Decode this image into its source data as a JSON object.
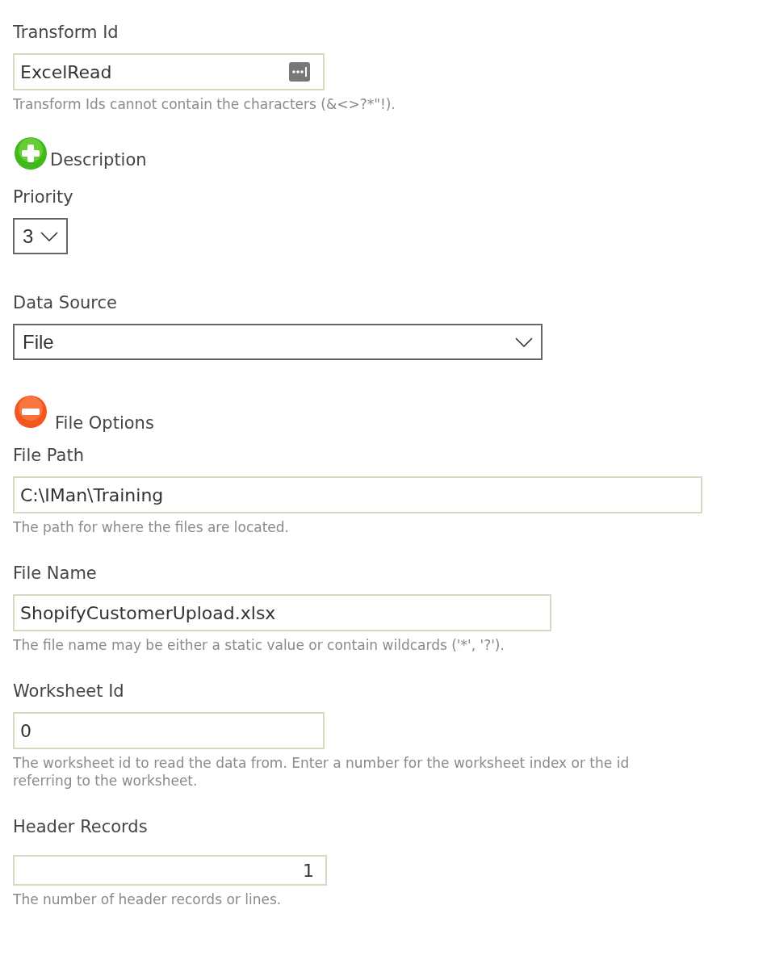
{
  "fields": [
    {
      "kind": "text",
      "label": "Transform Id",
      "value": "ExcelRead",
      "has_button": true,
      "hint": "Transform Ids cannot contain the characters (&<>?*\"!)."
    },
    {
      "kind": "toggle",
      "label": "Description",
      "expanded": false
    },
    {
      "kind": "select",
      "label": "Priority",
      "value": "3"
    },
    {
      "kind": "select",
      "label": "Data Source",
      "value": "File"
    },
    {
      "kind": "toggle",
      "label": "File Options",
      "expanded": true
    },
    {
      "kind": "text",
      "label": "File Path",
      "value": "C:\\IMan\\Training",
      "hint": "The path for where the files are located."
    },
    {
      "kind": "text",
      "label": "File Name",
      "value": "ShopifyCustomerUpload.xlsx",
      "hint": "The file name may be either a static value or contain wildcards ('*', '?')."
    },
    {
      "kind": "text",
      "label": "Worksheet Id",
      "value": "0",
      "hint": "The worksheet id to read the data from. Enter a number for the worksheet index or the id referring to the worksheet."
    },
    {
      "kind": "number",
      "label": "Header Records",
      "value": "1",
      "hint": "The number of header records or lines."
    }
  ]
}
